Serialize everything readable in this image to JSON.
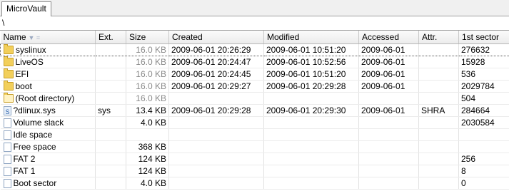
{
  "tab": {
    "label": "MicroVault"
  },
  "path": "\\",
  "columns": {
    "name": "Name",
    "ext": "Ext.",
    "size": "Size",
    "created": "Created",
    "modified": "Modified",
    "accessed": "Accessed",
    "attr": "Attr.",
    "sector": "1st sector"
  },
  "sort_indicator": "▼ =",
  "rows": [
    {
      "name": "syslinux",
      "ext": "",
      "size": "16.0 KB",
      "created": "2009-06-01  20:26:29",
      "modified": "2009-06-01  10:51:20",
      "accessed": "2009-06-01",
      "attr": "",
      "sector": "276632",
      "icon": "folder-icon"
    },
    {
      "name": "LiveOS",
      "ext": "",
      "size": "16.0 KB",
      "created": "2009-06-01  20:24:47",
      "modified": "2009-06-01  10:52:56",
      "accessed": "2009-06-01",
      "attr": "",
      "sector": "15928",
      "icon": "folder-icon"
    },
    {
      "name": "EFI",
      "ext": "",
      "size": "16.0 KB",
      "created": "2009-06-01  20:24:45",
      "modified": "2009-06-01  10:51:20",
      "accessed": "2009-06-01",
      "attr": "",
      "sector": "536",
      "icon": "folder-icon"
    },
    {
      "name": "boot",
      "ext": "",
      "size": "16.0 KB",
      "created": "2009-06-01  20:29:27",
      "modified": "2009-06-01  20:29:28",
      "accessed": "2009-06-01",
      "attr": "",
      "sector": "2029784",
      "icon": "folder-icon"
    },
    {
      "name": "(Root directory)",
      "ext": "",
      "size": "16.0 KB",
      "created": "",
      "modified": "",
      "accessed": "",
      "attr": "",
      "sector": "504",
      "icon": "parent-folder-icon"
    },
    {
      "name": "?dlinux.sys",
      "ext": "sys",
      "size": "13.4 KB",
      "created": "2009-06-01  20:29:28",
      "modified": "2009-06-01  20:29:30",
      "accessed": "2009-06-01",
      "attr": "SHRA",
      "sector": "284664",
      "icon": "system-file-icon"
    },
    {
      "name": "Volume slack",
      "ext": "",
      "size": "4.0 KB",
      "created": "",
      "modified": "",
      "accessed": "",
      "attr": "",
      "sector": "2030584",
      "icon": "file-icon"
    },
    {
      "name": "Idle space",
      "ext": "",
      "size": "",
      "created": "",
      "modified": "",
      "accessed": "",
      "attr": "",
      "sector": "",
      "icon": "file-icon"
    },
    {
      "name": "Free space",
      "ext": "",
      "size": "368 KB",
      "created": "",
      "modified": "",
      "accessed": "",
      "attr": "",
      "sector": "",
      "icon": "file-icon"
    },
    {
      "name": "FAT 2",
      "ext": "",
      "size": "124 KB",
      "created": "",
      "modified": "",
      "accessed": "",
      "attr": "",
      "sector": "256",
      "icon": "file-icon"
    },
    {
      "name": "FAT 1",
      "ext": "",
      "size": "124 KB",
      "created": "",
      "modified": "",
      "accessed": "",
      "attr": "",
      "sector": "8",
      "icon": "file-icon"
    },
    {
      "name": "Boot sector",
      "ext": "",
      "size": "4.0 KB",
      "created": "",
      "modified": "",
      "accessed": "",
      "attr": "",
      "sector": "0",
      "icon": "file-icon"
    }
  ]
}
